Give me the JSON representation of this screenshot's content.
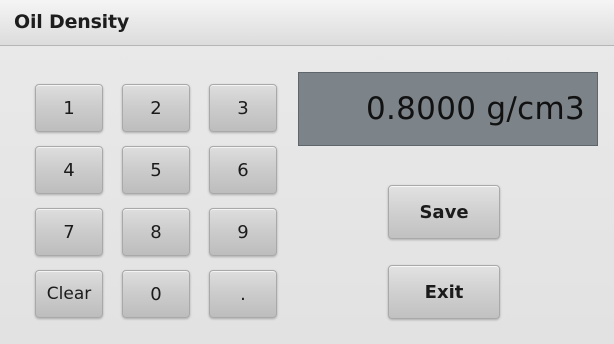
{
  "window": {
    "title": "Oil Density"
  },
  "display": {
    "value": "0.8000 g/cm3"
  },
  "keypad": {
    "keys": [
      "1",
      "2",
      "3",
      "4",
      "5",
      "6",
      "7",
      "8",
      "9",
      "Clear",
      "0",
      "."
    ]
  },
  "actions": {
    "save_label": "Save",
    "exit_label": "Exit"
  },
  "colors": {
    "display_background": "#7c848a",
    "background": "#e9e9e9"
  }
}
